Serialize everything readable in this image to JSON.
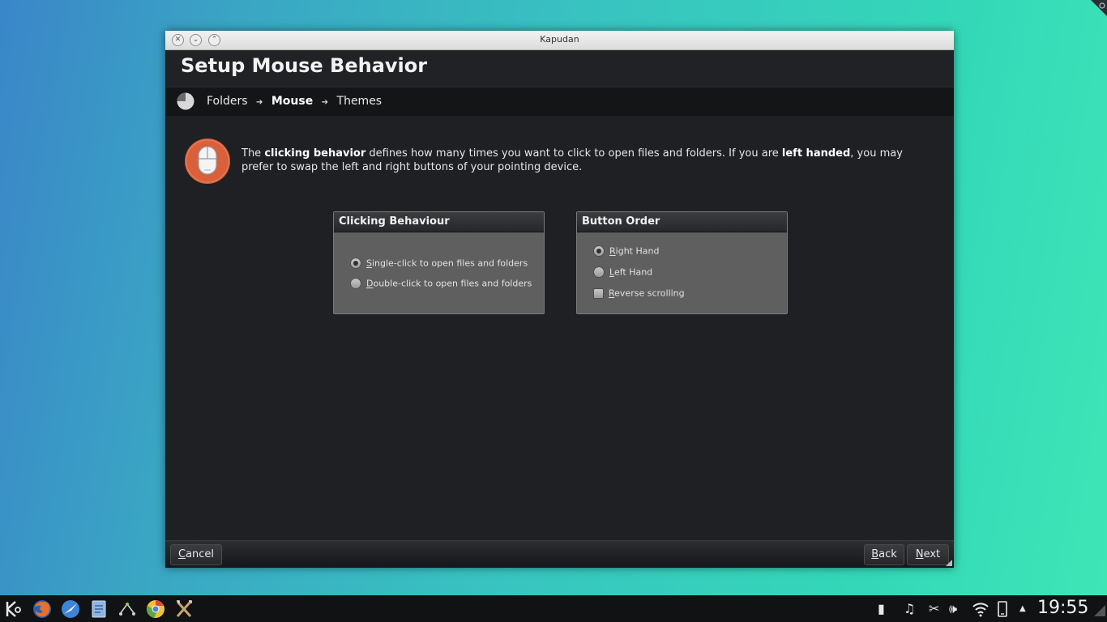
{
  "window": {
    "title": "Kapudan",
    "heading": "Setup Mouse Behavior"
  },
  "breadcrumb": {
    "items": [
      "Folders",
      "Mouse",
      "Themes"
    ],
    "current": "Mouse",
    "separator": "➔"
  },
  "intro": {
    "p1": "The ",
    "b1": "clicking behavior",
    "p2": " defines how many times you want to click to open files and folders. If you are ",
    "b2": "left handed",
    "p3": ", you may prefer to swap the left and right buttons of your pointing device."
  },
  "clicking_group": {
    "title": "Clicking Behaviour",
    "options": [
      {
        "mnemonic": "S",
        "rest": "ingle-click to open files and folders",
        "selected": true
      },
      {
        "mnemonic": "D",
        "rest": "ouble-click to open files and folders",
        "selected": false
      }
    ]
  },
  "button_group": {
    "title": "Button Order",
    "options": [
      {
        "mnemonic": "R",
        "rest": "ight Hand",
        "selected": true
      },
      {
        "mnemonic": "L",
        "rest": "eft Hand",
        "selected": false
      }
    ],
    "reverse": {
      "mnemonic": "R",
      "rest": "everse scrolling",
      "checked": false
    }
  },
  "footer": {
    "cancel": {
      "mnemonic": "C",
      "rest": "ancel"
    },
    "back": {
      "mnemonic": "B",
      "rest": "ack"
    },
    "next": {
      "mnemonic": "N",
      "rest": "ext"
    }
  },
  "taskbar": {
    "apps": [
      "kde-menu-icon",
      "firefox-icon",
      "browser-icon",
      "text-editor-icon",
      "network-manager-icon",
      "chrome-icon",
      "kapudan-icon"
    ],
    "clock": "19:55"
  },
  "colors": {
    "accent_mouse_icon": "#d9603b",
    "window_bg": "#1e2024"
  }
}
